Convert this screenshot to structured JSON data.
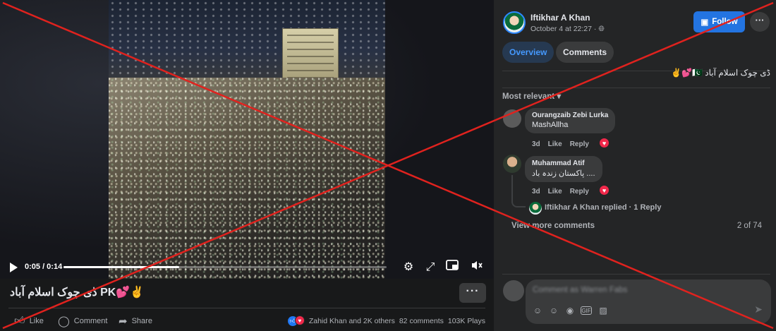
{
  "video": {
    "time_display": "0:05 / 0:14",
    "progress_fraction": 0.357
  },
  "post": {
    "title": "ڈی چوک اسلام آباد PK💕✌️",
    "more_label": "···"
  },
  "actions": {
    "like": "Like",
    "comment": "Comment",
    "share": "Share"
  },
  "stats": {
    "reactions": "Zahid Khan and 2K others",
    "comments": "82 comments",
    "plays": "103K Plays"
  },
  "side": {
    "author": "Iftikhar A Khan",
    "date": "October 4 at 22:27 · ",
    "follow_label": "Follow",
    "tabs": [
      "Overview",
      "Comments"
    ],
    "caption": "ڈی چوک اسلام آباد 🇵🇰💕✌️",
    "sort_label": "Most relevant ▾",
    "comments": [
      {
        "name": "Ourangzaib Zebi Lurka",
        "text": "MashAllha",
        "age": "3d",
        "like": "Like",
        "reply": "Reply"
      },
      {
        "name": "Muhammad Atif",
        "text": "پاکستان زندہ باد ....",
        "age": "3d",
        "like": "Like",
        "reply": "Reply"
      }
    ],
    "reply_summary": "Iftikhar A Khan replied · 1 Reply",
    "view_more": "View more comments",
    "count": "2 of 74",
    "composer_placeholder": "Comment as Warren Fabs"
  },
  "colors": {
    "accent": "#2374e1",
    "background": "#18191a",
    "panel": "#242526",
    "x_overlay": "#e0221e"
  }
}
